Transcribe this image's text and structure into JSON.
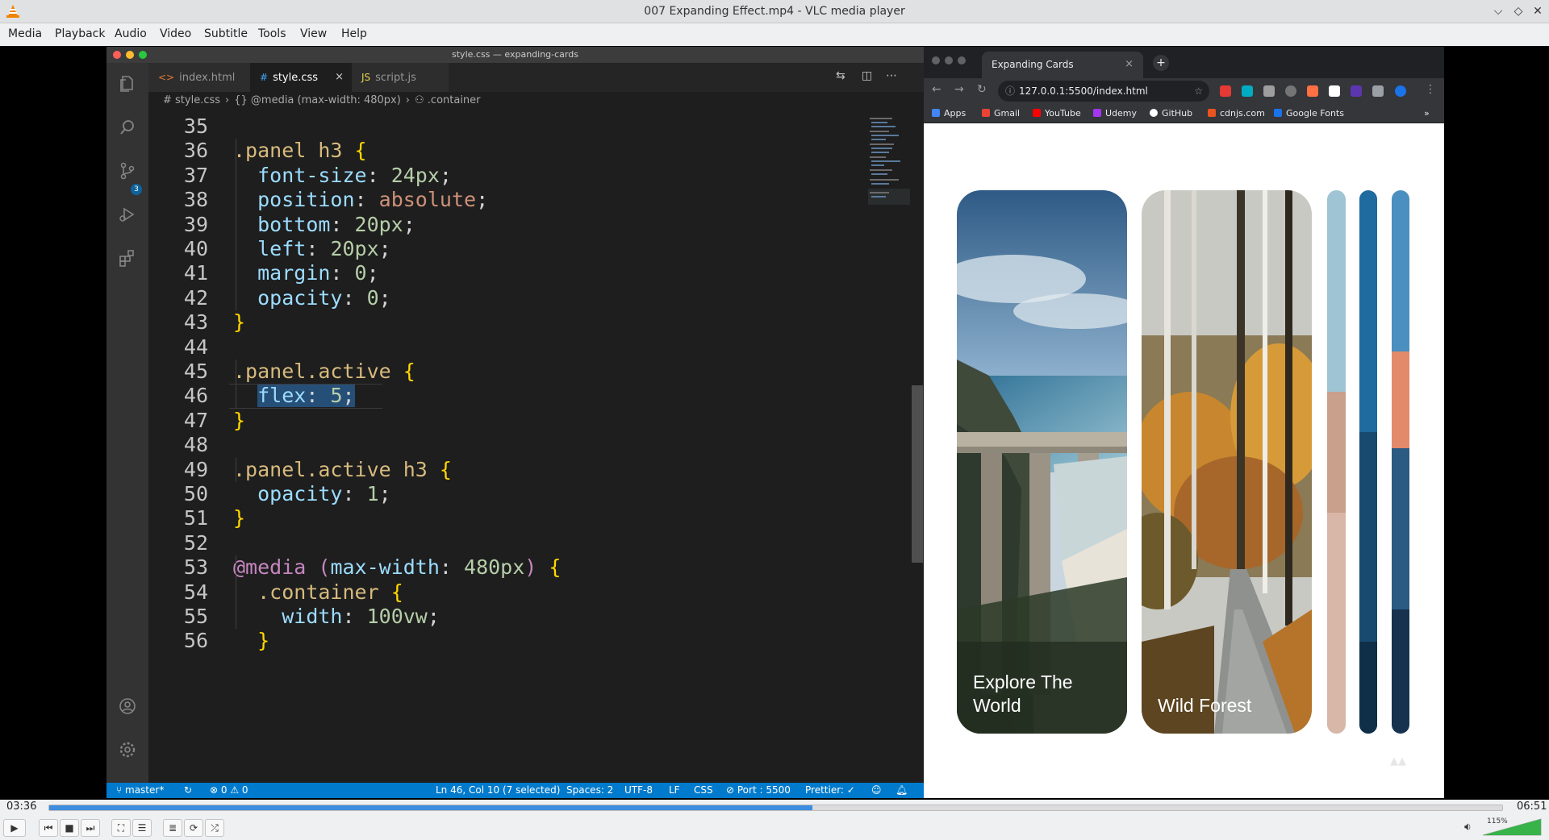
{
  "window": {
    "title": "007 Expanding Effect.mp4 - VLC media player"
  },
  "menu": [
    "Media",
    "Playback",
    "Audio",
    "Video",
    "Subtitle",
    "Tools",
    "View",
    "Help"
  ],
  "vscode": {
    "window_title": "style.css — expanding-cards",
    "tabs": [
      {
        "label": "index.html",
        "glyph": "<>",
        "active": false
      },
      {
        "label": "style.css",
        "glyph": "#",
        "active": true
      },
      {
        "label": "script.js",
        "glyph": "JS",
        "active": false
      }
    ],
    "tab_close": "×",
    "breadcrumb": [
      "# style.css",
      "{} @media (max-width: 480px)",
      "⚇ .container"
    ],
    "activity_badge": "3",
    "code_lines": [
      {
        "n": "35",
        "text": ""
      },
      {
        "n": "36",
        "text": ".panel h3 {"
      },
      {
        "n": "37",
        "text": "  font-size: 24px;"
      },
      {
        "n": "38",
        "text": "  position: absolute;"
      },
      {
        "n": "39",
        "text": "  bottom: 20px;"
      },
      {
        "n": "40",
        "text": "  left: 20px;"
      },
      {
        "n": "41",
        "text": "  margin: 0;"
      },
      {
        "n": "42",
        "text": "  opacity: 0;"
      },
      {
        "n": "43",
        "text": "}"
      },
      {
        "n": "44",
        "text": ""
      },
      {
        "n": "45",
        "text": ".panel.active {"
      },
      {
        "n": "46",
        "text": "  flex: 5;"
      },
      {
        "n": "47",
        "text": "}"
      },
      {
        "n": "48",
        "text": ""
      },
      {
        "n": "49",
        "text": ".panel.active h3 {"
      },
      {
        "n": "50",
        "text": "  opacity: 1;"
      },
      {
        "n": "51",
        "text": "}"
      },
      {
        "n": "52",
        "text": ""
      },
      {
        "n": "53",
        "text": "@media (max-width: 480px) {"
      },
      {
        "n": "54",
        "text": "  .container {"
      },
      {
        "n": "55",
        "text": "    width: 100vw;"
      },
      {
        "n": "56",
        "text": "  }"
      }
    ],
    "status": {
      "branch": "master*",
      "errors": "⊗ 0 ⚠ 0",
      "position": "Ln 46, Col 10 (7 selected)",
      "spaces": "Spaces: 2",
      "encoding": "UTF-8",
      "eol": "LF",
      "language": "CSS",
      "port": "⊘ Port : 5500",
      "prettier": "Prettier: ✓"
    }
  },
  "browser": {
    "tab_title": "Expanding Cards",
    "tab_close": "×",
    "new_tab": "+",
    "url": "127.0.0.1:5500/index.html",
    "bookmarks": [
      {
        "label": "Apps",
        "color": "#4285f4"
      },
      {
        "label": "Gmail",
        "color": "#ea4335"
      },
      {
        "label": "YouTube",
        "color": "#ff0000"
      },
      {
        "label": "Udemy",
        "color": "#a435f0"
      },
      {
        "label": "GitHub",
        "color": "#ffffff"
      },
      {
        "label": "cdnjs.com",
        "color": "#e95420"
      },
      {
        "label": "Google Fonts",
        "color": "#1a73e8"
      }
    ],
    "bookmarks_more": "»",
    "panels": [
      {
        "title": "Explore The World",
        "line1": "Explore The",
        "line2": "World"
      },
      {
        "title": "Wild Forest",
        "line1": "Wild Forest",
        "line2": ""
      }
    ]
  },
  "player": {
    "elapsed": "03:36",
    "total": "06:51",
    "progress": 0.525,
    "volume": "115%"
  },
  "colors": {
    "vscode_bg": "#1e1e1e",
    "status_bar": "#007acc",
    "selector": "#d7ba7d",
    "property": "#9cdcfe",
    "number": "#b5cea8",
    "keyword_value": "#ce9178",
    "bracket": "#ffd700",
    "at_rule": "#c586c0",
    "seek_fill": "#3d8de0"
  }
}
